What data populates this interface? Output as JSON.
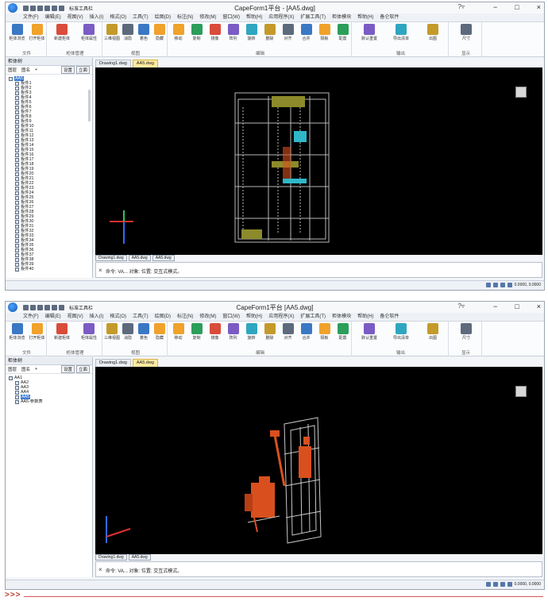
{
  "app": {
    "title": "CapeForm1平台 - [AA5.dwg]",
    "title2": "CapeForm1平台 [AA5.dwg]",
    "quick_access_label": "标准工具栏",
    "help": "?▿",
    "min": "−",
    "max": "□",
    "close": "×"
  },
  "menu": [
    "文件(F)",
    "编辑(E)",
    "视图(V)",
    "插入(I)",
    "格式(O)",
    "工具(T)",
    "绘图(D)",
    "标注(N)",
    "修改(M)",
    "窗口(W)",
    "帮助(H)",
    "应用程序(X)",
    "扩展工具(T)",
    "柜体模块",
    "帮助(H)",
    "备仑软件"
  ],
  "ribbon_tabs": [
    "常用",
    "插入",
    "注释",
    "参数化",
    "视图",
    "管理",
    "输出",
    "扩展工具",
    "应用",
    "协同",
    "更多",
    "智能模型",
    "BIM",
    "安装",
    "SuperForm"
  ],
  "ribbon_groups": [
    {
      "label": "文件",
      "buttons": [
        "柜体浏览",
        "打开柜体"
      ]
    },
    {
      "label": "柜体管理",
      "buttons": [
        "新建柜体",
        "柜体属性"
      ]
    },
    {
      "label": "视图",
      "buttons": [
        "三维视图",
        "消隐",
        "着色",
        "隐藏"
      ]
    },
    {
      "label": "编辑",
      "buttons": [
        "移动",
        "复制",
        "镜像",
        "阵列",
        "旋转",
        "删除",
        "对齐",
        "合并",
        "隔板",
        "配置"
      ]
    },
    {
      "label": "输出",
      "buttons": [
        "默认重置",
        "导出清单",
        "出图"
      ]
    },
    {
      "label": "显示",
      "buttons": [
        "尺寸"
      ]
    }
  ],
  "panel": {
    "title": "柜体树",
    "tools": [
      "图层",
      "图名",
      "+",
      "设置",
      "立面"
    ],
    "tree1": [
      "AA5",
      "板件1",
      "板件2",
      "板件3",
      "板件4",
      "板件5",
      "板件6",
      "板件7",
      "板件8",
      "板件9",
      "板件10",
      "板件11",
      "板件12",
      "板件13",
      "板件14",
      "板件15",
      "板件16",
      "板件17",
      "板件18",
      "板件19",
      "板件20",
      "板件21",
      "板件22",
      "板件23",
      "板件24",
      "板件25",
      "板件26",
      "板件27",
      "板件28",
      "板件29",
      "板件30",
      "板件31",
      "板件32",
      "板件33",
      "板件34",
      "板件35",
      "板件36",
      "板件37",
      "板件38",
      "板件39",
      "板件40"
    ],
    "tree2": [
      "AA1",
      "AA2",
      "AA3",
      "AA4",
      "AA5",
      "AA5-参数表"
    ]
  },
  "doc_tabs": [
    "Drawing1.dwg",
    "AA5.dwg"
  ],
  "model_tabs": [
    "Drawing1.dwg",
    "AA5.dwg",
    "AA5.dwg"
  ],
  "command": {
    "line1": "命令: VA... 对象: 位置: 交互式模式。",
    "line2": "命令: VA... 对象: 位置: 交互式模式。"
  },
  "status": {
    "coords": "0.0000, 0.0000"
  },
  "footer": {
    "arrows": ">>>"
  },
  "colors": {
    "accent": "#1558b0",
    "viewport": "#000000",
    "cabinet_frame": "#b8b8b8",
    "component_orange": "#d9501e",
    "component_cyan": "#2fb7c9",
    "component_olive": "#8c8a2a"
  }
}
